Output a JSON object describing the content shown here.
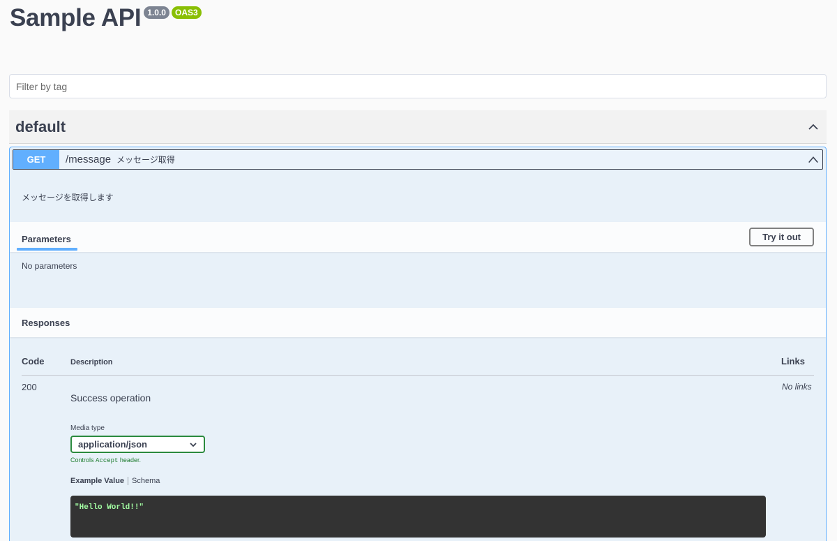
{
  "header": {
    "title": "Sample API",
    "version_badge": "1.0.0",
    "oas_badge": "OAS3"
  },
  "filter": {
    "placeholder": "Filter by tag"
  },
  "tag": {
    "name": "default"
  },
  "operation": {
    "method": "GET",
    "path": "/message",
    "summary": "メッセージ取得",
    "description": "メッセージを取得します",
    "parameters_tab": "Parameters",
    "try_button": "Try it out",
    "no_parameters": "No parameters",
    "responses_title": "Responses",
    "table_headers": {
      "code": "Code",
      "description": "Description",
      "links": "Links"
    },
    "responses": [
      {
        "code": "200",
        "description": "Success operation",
        "links": "No links",
        "media_type_label": "Media type",
        "media_type_value": "application/json",
        "media_hint_prefix": "Controls ",
        "media_hint_code": "Accept",
        "media_hint_suffix": " header.",
        "example_tab": "Example Value",
        "schema_tab": "Schema",
        "example_value": "\"Hello World!!\""
      }
    ]
  },
  "colors": {
    "get_method": "#61affe",
    "oas_badge": "#89bf04",
    "version_badge": "#7d8492",
    "code_background": "#333333",
    "code_text": "#a2fca2"
  },
  "icons": {
    "tag_toggle": "chevron-up-icon",
    "operation_toggle": "chevron-up-icon",
    "select_arrow": "chevron-down-icon"
  }
}
